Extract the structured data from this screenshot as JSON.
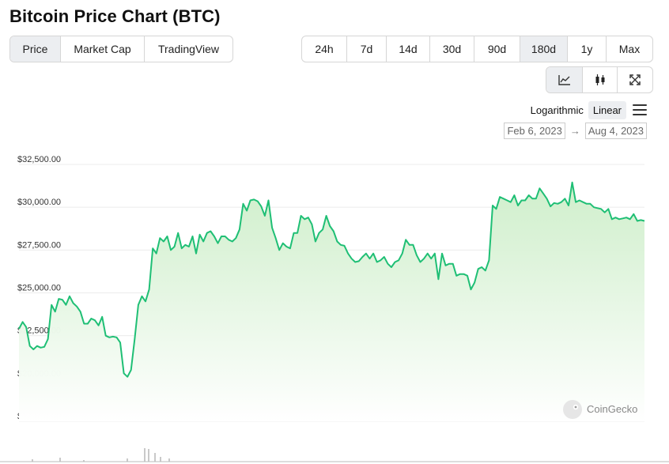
{
  "title": "Bitcoin Price Chart (BTC)",
  "tabs": [
    {
      "label": "Price",
      "active": true
    },
    {
      "label": "Market Cap",
      "active": false
    },
    {
      "label": "TradingView",
      "active": false
    }
  ],
  "ranges": [
    {
      "label": "24h",
      "active": false
    },
    {
      "label": "7d",
      "active": false
    },
    {
      "label": "14d",
      "active": false
    },
    {
      "label": "30d",
      "active": false
    },
    {
      "label": "90d",
      "active": false
    },
    {
      "label": "180d",
      "active": true
    },
    {
      "label": "1y",
      "active": false
    },
    {
      "label": "Max",
      "active": false
    }
  ],
  "tools": [
    {
      "icon": "line-chart-icon",
      "active": true
    },
    {
      "icon": "candlestick-icon",
      "active": false
    },
    {
      "icon": "expand-icon",
      "active": false
    }
  ],
  "scale": {
    "log_label": "Logarithmic",
    "linear_label": "Linear",
    "selected": "Linear"
  },
  "date_range": {
    "from": "Feb 6, 2023",
    "to": "Aug 4, 2023",
    "separator": "→"
  },
  "watermark": "CoinGecko",
  "colors": {
    "line": "#1fbf75",
    "fill_top": "#cdeec9",
    "active_bg": "#eceef1"
  },
  "chart_data": {
    "type": "area",
    "x_start": "Feb 6, 2023",
    "x_end": "Aug 4, 2023",
    "ylim": [
      17500,
      32500
    ],
    "y_ticks": [
      "$32,500.00",
      "$30,000.00",
      "$27,500.00",
      "$25,000.00",
      "$22,500.00",
      "$20,000.00",
      "$17,500.00"
    ],
    "y_tick_values": [
      32500,
      30000,
      27500,
      25000,
      22500,
      20000,
      17500
    ],
    "grid": true,
    "values": [
      22900,
      23300,
      23000,
      21900,
      21700,
      21900,
      21800,
      21850,
      22300,
      24300,
      23900,
      24650,
      24600,
      24300,
      24800,
      24400,
      24200,
      23900,
      23200,
      23200,
      23500,
      23400,
      23100,
      23600,
      22500,
      22400,
      22450,
      22400,
      22100,
      20300,
      20100,
      20500,
      22300,
      24300,
      24800,
      24500,
      25200,
      27600,
      27300,
      28200,
      28000,
      28300,
      27500,
      27700,
      28500,
      27600,
      27800,
      27700,
      28300,
      27300,
      28400,
      28000,
      28500,
      28600,
      28300,
      27900,
      28300,
      28300,
      28100,
      28000,
      28200,
      28700,
      30200,
      29800,
      30400,
      30450,
      30350,
      30050,
      29500,
      30400,
      28800,
      28200,
      27500,
      27900,
      27700,
      27600,
      28500,
      28500,
      29500,
      29300,
      29400,
      29000,
      28000,
      28500,
      28700,
      29500,
      28900,
      28600,
      28000,
      27800,
      27750,
      27300,
      27000,
      26800,
      26850,
      27100,
      27300,
      27000,
      27300,
      26800,
      26900,
      27100,
      26700,
      26500,
      26800,
      26900,
      27300,
      28100,
      27800,
      27800,
      27200,
      26800,
      27000,
      27300,
      27000,
      27300,
      25800,
      27300,
      26600,
      26700,
      26700,
      26000,
      26100,
      26100,
      26000,
      25200,
      25600,
      26400,
      26500,
      26300,
      26900,
      30100,
      29900,
      30600,
      30500,
      30400,
      30300,
      30700,
      30100,
      30400,
      30400,
      30700,
      30500,
      30500,
      31100,
      30800,
      30500,
      30050,
      30250,
      30200,
      30300,
      30500,
      30100,
      31450,
      30300,
      30400,
      30300,
      30200,
      30200,
      30000,
      29950,
      29900,
      29700,
      29900,
      29300,
      29400,
      29300,
      29350,
      29400,
      29300,
      29600,
      29200,
      29250,
      29200
    ]
  }
}
